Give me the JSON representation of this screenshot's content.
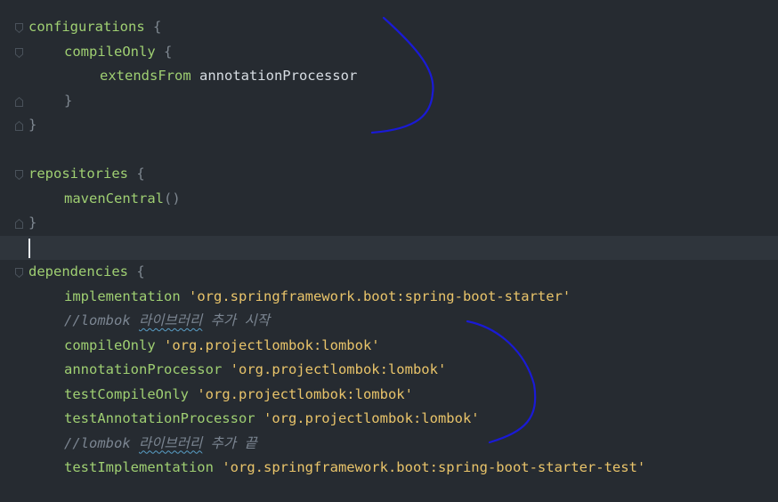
{
  "editor": {
    "lines": [
      {
        "id": "configurations-open",
        "indent": 0,
        "tokens": [
          {
            "t": "configurations",
            "c": "kw-fn"
          },
          {
            "t": " {",
            "c": "brace"
          }
        ],
        "fold": "open"
      },
      {
        "id": "compileonly-open",
        "indent": 1,
        "tokens": [
          {
            "t": "compileOnly",
            "c": "kw-fn"
          },
          {
            "t": " {",
            "c": "brace"
          }
        ],
        "fold": "open"
      },
      {
        "id": "extendsfrom",
        "indent": 2,
        "tokens": [
          {
            "t": "extendsFrom",
            "c": "kw-fn"
          },
          {
            "t": " annotationProcessor",
            "c": "plain"
          }
        ]
      },
      {
        "id": "compileonly-close",
        "indent": 1,
        "tokens": [
          {
            "t": "}",
            "c": "brace"
          }
        ],
        "fold": "close"
      },
      {
        "id": "configurations-close",
        "indent": 0,
        "tokens": [
          {
            "t": "}",
            "c": "brace"
          }
        ],
        "fold": "close"
      },
      {
        "id": "blank-1",
        "indent": 0,
        "tokens": []
      },
      {
        "id": "repositories-open",
        "indent": 0,
        "tokens": [
          {
            "t": "repositories",
            "c": "kw-fn"
          },
          {
            "t": " {",
            "c": "brace"
          }
        ],
        "fold": "open"
      },
      {
        "id": "mavencentral",
        "indent": 1,
        "tokens": [
          {
            "t": "mavenCentral",
            "c": "kw-fn"
          },
          {
            "t": "()",
            "c": "brace"
          }
        ]
      },
      {
        "id": "repositories-close",
        "indent": 0,
        "tokens": [
          {
            "t": "}",
            "c": "brace"
          }
        ],
        "fold": "close"
      },
      {
        "id": "current-blank",
        "indent": 0,
        "tokens": [],
        "current": true
      },
      {
        "id": "dependencies-open",
        "indent": 0,
        "tokens": [
          {
            "t": "dependencies",
            "c": "kw-fn"
          },
          {
            "t": " {",
            "c": "brace"
          }
        ],
        "fold": "open"
      },
      {
        "id": "implementation",
        "indent": 1,
        "tokens": [
          {
            "t": "implementation",
            "c": "kw-fn"
          },
          {
            "t": " ",
            "c": "plain"
          },
          {
            "t": "'org.springframework.boot:spring-boot-starter'",
            "c": "str"
          }
        ]
      },
      {
        "id": "comment-start",
        "indent": 1,
        "tokens": [
          {
            "t": "//lombok ",
            "c": "comment"
          },
          {
            "t": "라이브러리",
            "c": "comment squiggle"
          },
          {
            "t": " 추가 시작",
            "c": "comment"
          }
        ]
      },
      {
        "id": "compileonly-lombok",
        "indent": 1,
        "tokens": [
          {
            "t": "compileOnly",
            "c": "kw-fn"
          },
          {
            "t": " ",
            "c": "plain"
          },
          {
            "t": "'org.projectlombok:lombok'",
            "c": "str"
          }
        ]
      },
      {
        "id": "annotationprocessor-lombok",
        "indent": 1,
        "tokens": [
          {
            "t": "annotationProcessor",
            "c": "kw-fn"
          },
          {
            "t": " ",
            "c": "plain"
          },
          {
            "t": "'org.projectlombok:lombok'",
            "c": "str"
          }
        ]
      },
      {
        "id": "testcompileonly-lombok",
        "indent": 1,
        "tokens": [
          {
            "t": "testCompileOnly",
            "c": "kw-fn"
          },
          {
            "t": " ",
            "c": "plain"
          },
          {
            "t": "'org.projectlombok:lombok'",
            "c": "str"
          }
        ]
      },
      {
        "id": "testannotationprocessor-lombok",
        "indent": 1,
        "tokens": [
          {
            "t": "testAnnotationProcessor",
            "c": "kw-fn"
          },
          {
            "t": " ",
            "c": "plain"
          },
          {
            "t": "'org.projectlombok:lombok'",
            "c": "str"
          }
        ]
      },
      {
        "id": "comment-end",
        "indent": 1,
        "tokens": [
          {
            "t": "//lombok ",
            "c": "comment"
          },
          {
            "t": "라이브러리",
            "c": "comment squiggle"
          },
          {
            "t": " 추가 끝",
            "c": "comment"
          }
        ]
      },
      {
        "id": "testimplementation",
        "indent": 1,
        "tokens": [
          {
            "t": "testImplementation",
            "c": "kw-fn"
          },
          {
            "t": " ",
            "c": "plain"
          },
          {
            "t": "'org.springframework.boot:spring-boot-starter-test'",
            "c": "str"
          }
        ]
      }
    ]
  },
  "colors": {
    "background": "#262b31",
    "current_line": "#2f353c",
    "function": "#9fcf72",
    "string": "#e9c46a",
    "comment": "#7b8591",
    "annotation_stroke": "#1a1ad6"
  }
}
